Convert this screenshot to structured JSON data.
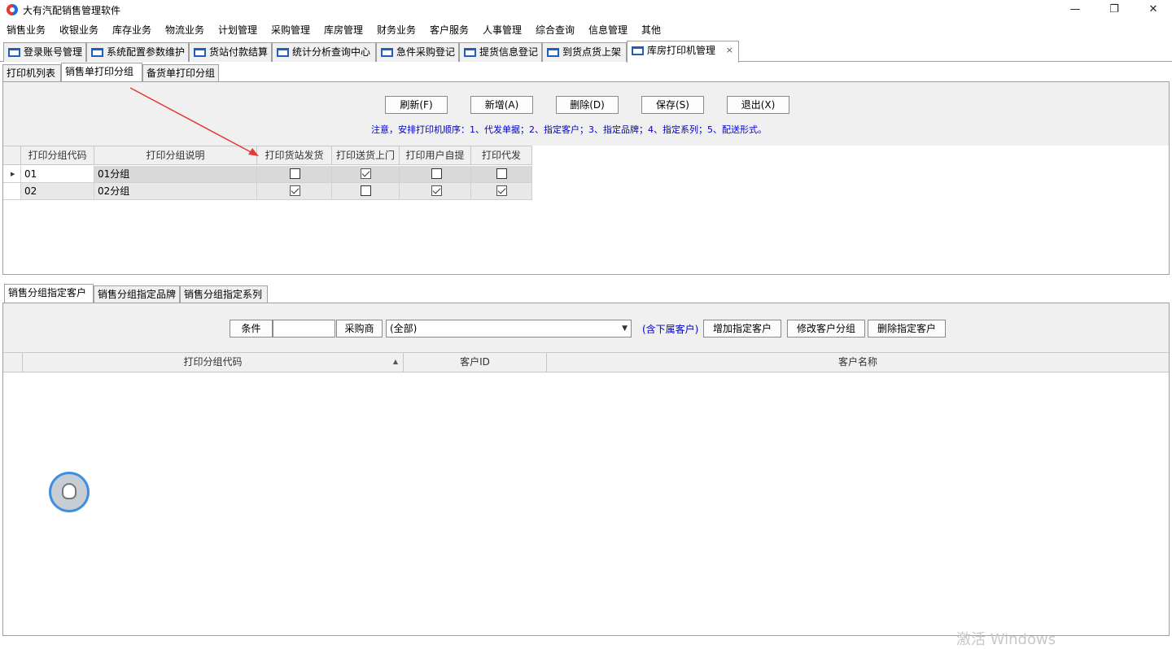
{
  "app": {
    "title": "大有汽配销售管理软件"
  },
  "window_controls": {
    "minimize": "—",
    "restore": "❐",
    "close": "✕"
  },
  "menu": [
    "销售业务",
    "收银业务",
    "库存业务",
    "物流业务",
    "计划管理",
    "采购管理",
    "库房管理",
    "财务业务",
    "客户服务",
    "人事管理",
    "综合查询",
    "信息管理",
    "其他"
  ],
  "doc_tabs": [
    "登录账号管理",
    "系统配置参数维护",
    "货站付款结算",
    "统计分析查询中心",
    "急件采购登记",
    "提货信息登记",
    "到货点货上架",
    "库房打印机管理"
  ],
  "doc_tab_close": "×",
  "sub_tabs": [
    "打印机列表",
    "销售单打印分组",
    "备货单打印分组"
  ],
  "toolbar": {
    "refresh": "刷新(F)",
    "add": "新增(A)",
    "delete": "删除(D)",
    "save": "保存(S)",
    "exit": "退出(X)"
  },
  "note": "注意，安排打印机顺序：1、代发单据；2、指定客户；3、指定品牌；4、指定系列；5、配送形式。",
  "group_grid": {
    "columns": [
      "打印分组代码",
      "打印分组说明",
      "打印货站发货",
      "打印送货上门",
      "打印用户自提",
      "打印代发"
    ],
    "rows": [
      {
        "code": "01",
        "desc": "01分组",
        "station": false,
        "delivery": true,
        "pickup": false,
        "proxy": false
      },
      {
        "code": "02",
        "desc": "02分组",
        "station": true,
        "delivery": false,
        "pickup": true,
        "proxy": true
      }
    ]
  },
  "bottom_tabs": [
    "销售分组指定客户",
    "销售分组指定品牌",
    "销售分组指定系列"
  ],
  "filter": {
    "condition_label": "条件",
    "condition_value": "",
    "buyer_label": "采购商",
    "buyer_select": "(全部)",
    "include_sub": "(含下属客户)",
    "add_btn": "增加指定客户",
    "modify_btn": "修改客户分组",
    "delete_btn": "删除指定客户"
  },
  "customer_grid": {
    "columns": [
      "打印分组代码",
      "客户ID",
      "客户名称"
    ]
  },
  "watermark": "激活 Windows",
  "colors": {
    "note_blue": "#0000c8",
    "arrow_red": "#e53935",
    "tab_bg": "#f0f0f0"
  }
}
